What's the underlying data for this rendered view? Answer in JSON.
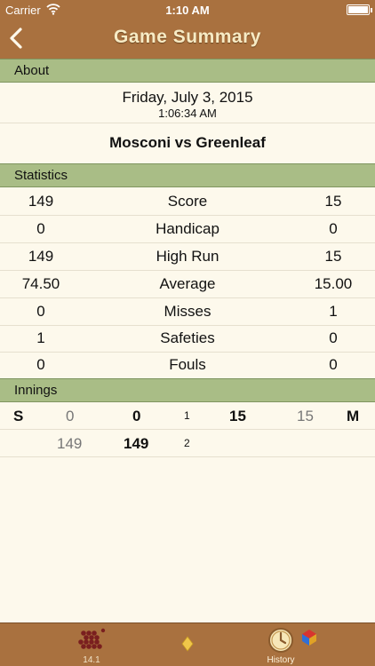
{
  "status_bar": {
    "carrier": "Carrier",
    "time": "1:10 AM"
  },
  "nav": {
    "title": "Game Summary",
    "back_icon": "chevron-left-icon"
  },
  "about": {
    "header": "About",
    "date": "Friday, July 3, 2015",
    "time": "1:06:34 AM",
    "match": "Mosconi vs Greenleaf"
  },
  "statistics": {
    "header": "Statistics",
    "rows": [
      {
        "label": "Score",
        "left": "149",
        "right": "15"
      },
      {
        "label": "Handicap",
        "left": "0",
        "right": "0"
      },
      {
        "label": "High Run",
        "left": "149",
        "right": "15"
      },
      {
        "label": "Average",
        "left": "74.50",
        "right": "15.00"
      },
      {
        "label": "Misses",
        "left": "0",
        "right": "1"
      },
      {
        "label": "Safeties",
        "left": "1",
        "right": "0"
      },
      {
        "label": "Fouls",
        "left": "0",
        "right": "0"
      }
    ]
  },
  "innings": {
    "header": "Innings",
    "row1": {
      "left_tag": "S",
      "left_pts": "0",
      "left_total": "0",
      "num": "1",
      "right_total": "15",
      "right_pts": "15",
      "right_tag": "M"
    },
    "row2": {
      "left_pts": "149",
      "left_total": "149",
      "num": "2"
    }
  },
  "tabbar": {
    "tabs": [
      {
        "label": "14.1",
        "icon": "rack-balls-icon"
      },
      {
        "label": "",
        "icon": "diamond-icon"
      },
      {
        "label": "History",
        "icon": "clock-icon"
      }
    ],
    "badge_icon": "colored-gem-icon"
  },
  "colors": {
    "bar": "#a9713f",
    "section": "#a9bd86",
    "background": "#fdf9ec"
  }
}
